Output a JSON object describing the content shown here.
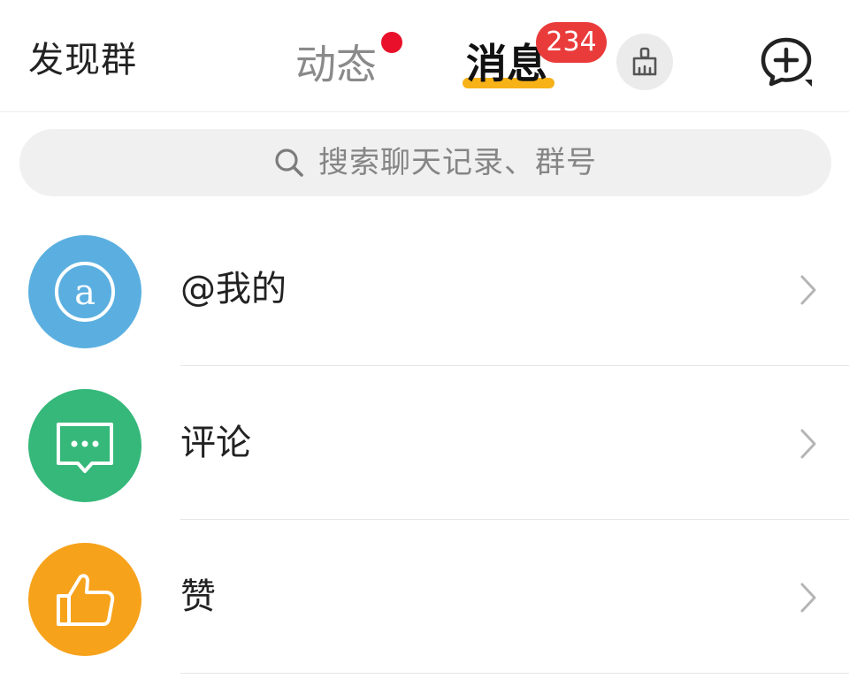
{
  "header": {
    "discover_label": "发现群",
    "tabs": [
      {
        "label": "动态",
        "has_dot": true
      },
      {
        "label": "消息",
        "selected": true,
        "badge": "234"
      }
    ],
    "clean_icon": "broom-icon",
    "compose_icon": "add-chat-icon"
  },
  "search": {
    "placeholder": "搜索聊天记录、群号",
    "icon": "search-icon"
  },
  "notifications": [
    {
      "label": "@我的",
      "icon": "at-icon",
      "color": "#5aafe0"
    },
    {
      "label": "评论",
      "icon": "comment-icon",
      "color": "#35b87a"
    },
    {
      "label": "赞",
      "icon": "thumbs-up-icon",
      "color": "#f7a21b"
    }
  ],
  "colors": {
    "accent": "#f7b218",
    "badge": "#ea3b3b"
  }
}
